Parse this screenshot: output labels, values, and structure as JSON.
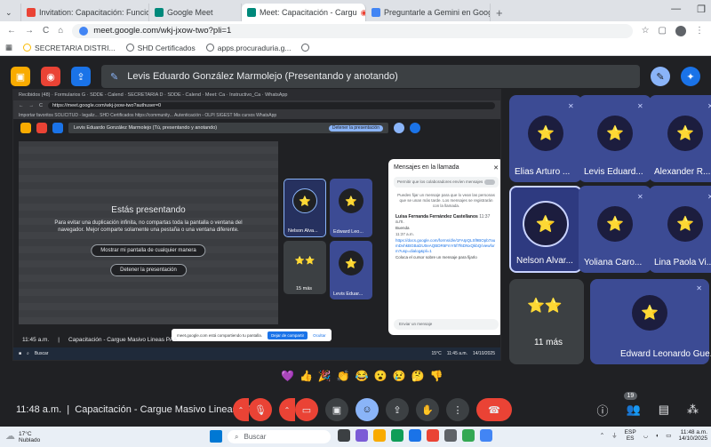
{
  "browser": {
    "tabs": [
      {
        "label": "Invitation: Capacitación: Funcio",
        "color": "#ea4335",
        "active": false
      },
      {
        "label": "Google Meet",
        "color": "#00897b",
        "active": false
      },
      {
        "label": "Meet: Capacitación - Cargu",
        "color": "#00897b",
        "active": true
      },
      {
        "label": "Preguntarle a Gemini en Googl",
        "color": "#4285f4",
        "active": false
      }
    ],
    "url": "meet.google.com/wkj-jxow-two?pli=1",
    "bookmarks": [
      "SECRETARIA DISTRI...",
      "SHD Certificados",
      "apps.procuraduria.g..."
    ]
  },
  "meet": {
    "presenter_banner": "Levis Eduardo González Marmolejo (Presentando y anotando)",
    "meeting_time": "11:48 a.m.",
    "meeting_title": "Capacitación - Cargue Masivo Lineas PAA",
    "people_count": "19",
    "participants": [
      {
        "name": "Elias Arturo ..."
      },
      {
        "name": "Levis Eduard..."
      },
      {
        "name": "Alexander R..."
      },
      {
        "name": "Nelson Alvar..."
      },
      {
        "name": "Yoliana Caro..."
      },
      {
        "name": "Lina Paola Vi..."
      },
      {
        "name": "11 más"
      },
      {
        "name": "Edward Leonardo Gue..."
      }
    ],
    "reactions": [
      "💜",
      "👍",
      "🎉",
      "👏",
      "😂",
      "😮",
      "😢",
      "🤔",
      "👎"
    ]
  },
  "inner": {
    "tab_text": "Recibidos (48) · Formularios G · SDDE - Calend · SECRETARIA D · SDDE - Calend · Meet: Ca · Instructivo_Ca · WhatsApp",
    "url": "https://meet.google.com/wkj-jxow-two?authuser=0",
    "bookmarks_text": "Importar favoritos   SOLICITUD - legaliz...   SHD Certificados   https://community...   Autenticación - OLPI   SIGEST   Mis cursos   WhatsApp",
    "banner": "Levis Eduardo González Marmolejo (Tú, presentando y anotando)",
    "stop_label": "Detener la presentación",
    "pres_title": "Estás presentando",
    "pres_desc": "Para evitar una duplicación infinita, no compartas toda la pantalla o ventana del navegador. Mejor comparte solamente una pestaña o una ventana diferente.",
    "show_btn": "Mostrar mi pantalla de cualquier manera",
    "stop_btn": "Detener la presentación",
    "tiles": [
      {
        "name": "Nelson Alva..."
      },
      {
        "name": "Edward Leo..."
      },
      {
        "name": "15 más"
      },
      {
        "name": "Levis Eduar..."
      }
    ],
    "chat": {
      "title": "Mensajes en la llamada",
      "toggle": "Permitir que los colaboradores envíen mensajes",
      "note": "Puedes fijar un mensaje para que lo vean las personas que se unan más tarde. Los mensajes se registrarán con la llamada.",
      "sender": "Luisa Fernanda Fernández Castellanos",
      "sender_time": "11:37 a.m.",
      "msg": "Buenda",
      "time2": "11:37 a.m.",
      "link": "https://docs.google.com/forms/d/e/1FAIpQLSf9BOpb7aumDvhkBGBal2U0eAQBDR6FmY5f7f6DNxQkbQ/viewform?usp=dialog&pli=1",
      "attach": "Coloca el cursor sobre un mensaje para fijarlo",
      "input": "Enviar un mensaje"
    },
    "share_text": "meet.google.com está compartiendo tu pantalla.",
    "share_stop": "Dejar de compartir",
    "share_hide": "Ocultar",
    "bottom_time": "11:45 a.m.",
    "bottom_title": "Capacitación - Cargue Masivo Lineas PAA",
    "search": "Buscar",
    "temp": "15°C",
    "tray_time": "11:45 a.m.",
    "tray_date": "14/10/2025"
  },
  "taskbar": {
    "temp": "17°C",
    "weather": "Nublado",
    "search": "Buscar",
    "lang": "ESP",
    "region": "ES",
    "time": "11:48 a.m.",
    "date": "14/10/2025"
  }
}
